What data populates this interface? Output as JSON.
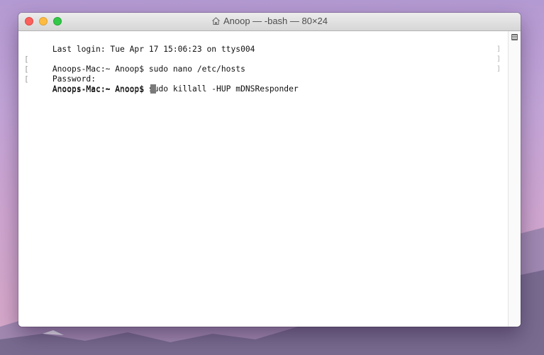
{
  "window": {
    "title": "Anoop — -bash — 80×24",
    "title_icon": "home-icon"
  },
  "terminal": {
    "lines": [
      {
        "text": "Last login: Tue Apr 17 15:06:23 on ttys004"
      },
      {
        "text": "Anoops-Mac:~ Anoop$ sudo nano /etc/hosts"
      },
      {
        "text": "Password:"
      },
      {
        "text": "Anoops-Mac:~ Anoop$ sudo killall -HUP mDNSResponder"
      },
      {
        "text": "Anoops-Mac:~ Anoop$ "
      }
    ],
    "mark_left": "[",
    "mark_right": "]"
  },
  "colors": {
    "close": "#fc605c",
    "minimize": "#fdbc40",
    "zoom": "#34c84a",
    "cursor": "#7a7a7a"
  }
}
